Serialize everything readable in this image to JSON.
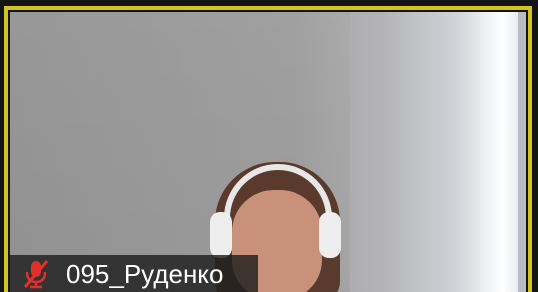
{
  "participant": {
    "name": "095_Руденко",
    "mic_icon": "mic-muted-icon",
    "active_speaker": true
  },
  "colors": {
    "speaker_border": "#d4c21f",
    "mic_muted": "#e0302b",
    "nameplate_bg": "#1e1e1e",
    "name_text": "#ffffff"
  }
}
